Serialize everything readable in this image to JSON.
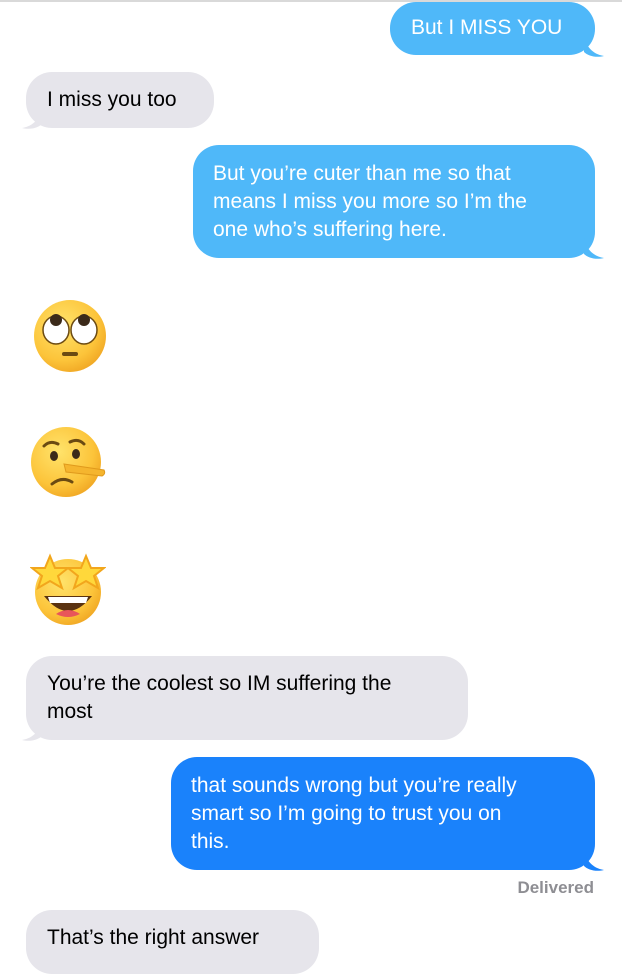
{
  "conversation": {
    "messages": [
      {
        "direction": "sent",
        "text": "But I MISS YOU"
      },
      {
        "direction": "received",
        "text": "I miss you too"
      },
      {
        "direction": "sent",
        "text": "But you’re cuter than me so that\nmeans I miss you more so I’m the\none who’s suffering here."
      },
      {
        "direction": "received",
        "emoji": "face-with-rolling-eyes"
      },
      {
        "direction": "received",
        "emoji": "lying-face"
      },
      {
        "direction": "received",
        "emoji": "star-struck"
      },
      {
        "direction": "received",
        "text": "You’re the coolest so IM suffering the\nmost"
      },
      {
        "direction": "sent",
        "text": "that sounds wrong but you’re really\nsmart so I’m going to trust you on\nthis."
      },
      {
        "direction": "received",
        "text": "That’s the right answer"
      }
    ],
    "status": "Delivered"
  },
  "colors": {
    "sent_light": "#4fb8f9",
    "sent_dark": "#1a82fb",
    "received": "#e6e5eb",
    "status_text": "#8e8e93"
  }
}
